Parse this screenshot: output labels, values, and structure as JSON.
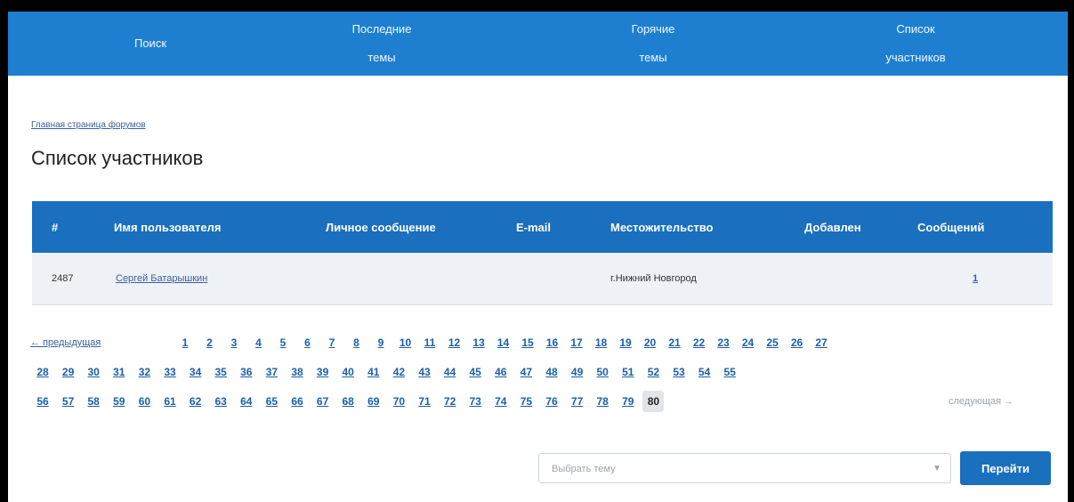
{
  "nav": {
    "items": [
      {
        "line1": "Поиск",
        "line2": ""
      },
      {
        "line1": "Последние",
        "line2": "темы"
      },
      {
        "line1": "Горячие",
        "line2": "темы"
      },
      {
        "line1": "Список",
        "line2": "участников"
      }
    ]
  },
  "breadcrumb": "Главная страница форумов",
  "page_title": "Список участников",
  "table": {
    "headers": [
      "#",
      "Имя пользователя",
      "Личное сообщение",
      "E-mail",
      "Местожительство",
      "Добавлен",
      "Сообщений"
    ],
    "rows": [
      {
        "num": "2487",
        "username": "Сергей Батарышкин",
        "pm": "",
        "email": "",
        "location": "г.Нижний Новгород",
        "added": "",
        "posts": "1"
      }
    ]
  },
  "pagination": {
    "prev_label": "← предыдущая",
    "next_label": "следующая →",
    "current_page": "80",
    "pages_row1": [
      "1",
      "2",
      "3",
      "4",
      "5",
      "6",
      "7",
      "8",
      "9",
      "10",
      "11",
      "12",
      "13",
      "14",
      "15",
      "16",
      "17",
      "18",
      "19",
      "20",
      "21",
      "22",
      "23",
      "24",
      "25",
      "26",
      "27"
    ],
    "pages_row2": [
      "28",
      "29",
      "30",
      "31",
      "32",
      "33",
      "34",
      "35",
      "36",
      "37",
      "38",
      "39",
      "40",
      "41",
      "42",
      "43",
      "44",
      "45",
      "46",
      "47",
      "48",
      "49",
      "50",
      "51",
      "52",
      "53",
      "54",
      "55"
    ],
    "pages_row3": [
      "56",
      "57",
      "58",
      "59",
      "60",
      "61",
      "62",
      "63",
      "64",
      "65",
      "66",
      "67",
      "68",
      "69",
      "70",
      "71",
      "72",
      "73",
      "74",
      "75",
      "76",
      "77",
      "78",
      "79",
      "80"
    ]
  },
  "page_select": {
    "placeholder": "Выбрать тему",
    "icon": "chevron-down-icon"
  },
  "go_button": "Перейти",
  "colors": {
    "nav_bg": "#1e7fd1",
    "table_header_bg": "#1a6fbf",
    "link": "#1a5fa8",
    "row_bg": "#eef1f6"
  }
}
